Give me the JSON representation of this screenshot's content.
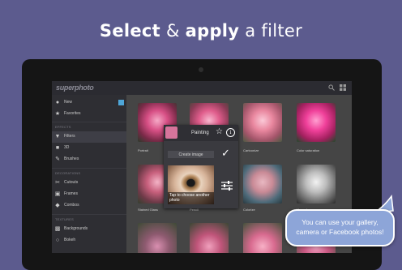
{
  "headline": {
    "part1": "Select",
    "part2": "&",
    "part3": "apply",
    "part4": "a filter"
  },
  "app": {
    "logo": "superphoto"
  },
  "sidebar": {
    "items": [
      {
        "label": "New",
        "icon": "drop-icon"
      },
      {
        "label": "Favorites",
        "icon": "star-icon"
      },
      {
        "label": "Filters",
        "icon": "funnel-icon"
      },
      {
        "label": "3D",
        "icon": "cube-icon"
      },
      {
        "label": "Brushes",
        "icon": "brush-icon"
      },
      {
        "label": "Cutouts",
        "icon": "scissors-icon"
      },
      {
        "label": "Frames",
        "icon": "frame-icon"
      },
      {
        "label": "Combos",
        "icon": "combo-icon"
      },
      {
        "label": "Backgrounds",
        "icon": "background-icon"
      },
      {
        "label": "Bokeh",
        "icon": "bokeh-icon"
      }
    ],
    "sections": [
      "EFFECTS",
      "DECORATIONS",
      "TEXTURES"
    ]
  },
  "grid": {
    "captions": [
      "Portrait",
      "Painting",
      "Cartoonize",
      "Color saturation",
      "Stained Glass",
      "Pencil",
      "Colorize",
      "Monochrome"
    ]
  },
  "dialog": {
    "title": "Painting",
    "create_label": "Create image",
    "photo_caption": "Tap to choose another photo"
  },
  "bubble": {
    "line1": "You can use your gallery,",
    "line2": "camera or Facebook photos!"
  },
  "colors": {
    "background": "#5c5b8e",
    "accent": "#4ea6d8",
    "bubble": "#8da5d8"
  }
}
